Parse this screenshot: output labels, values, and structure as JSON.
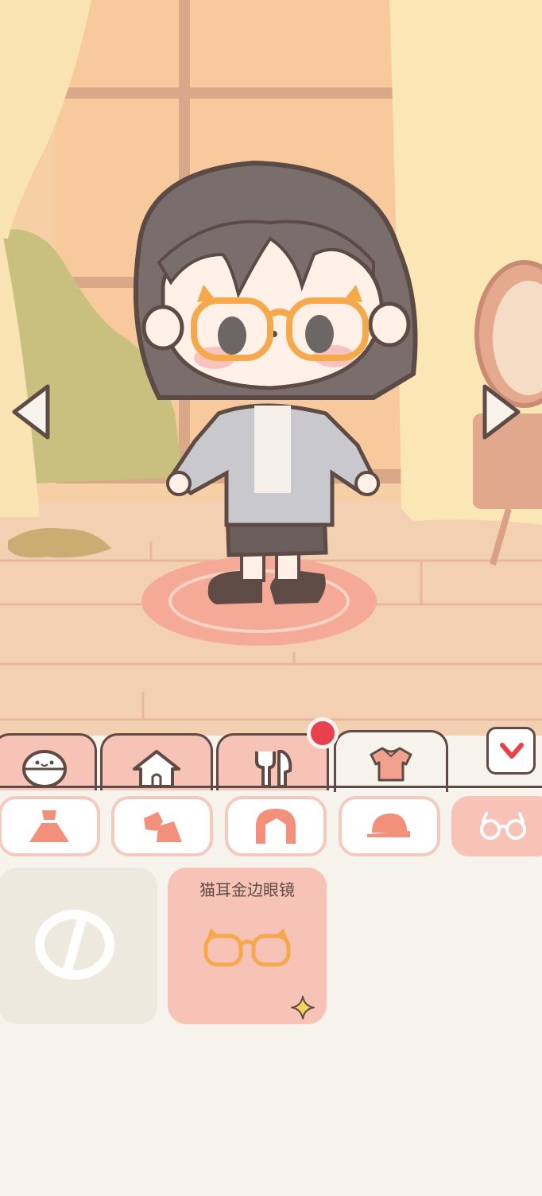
{
  "tabs": [
    {
      "id": "face",
      "icon": "face-icon"
    },
    {
      "id": "home",
      "icon": "home-icon"
    },
    {
      "id": "food",
      "icon": "fork-spoon-icon"
    },
    {
      "id": "clothes",
      "icon": "shirt-icon",
      "active": true
    }
  ],
  "notification": {
    "visible": true,
    "color": "#e8404c"
  },
  "categories": [
    {
      "id": "dress",
      "icon": "dress-icon"
    },
    {
      "id": "shoes",
      "icon": "shoes-icon"
    },
    {
      "id": "hair",
      "icon": "hair-icon"
    },
    {
      "id": "hat",
      "icon": "cap-icon"
    },
    {
      "id": "glasses",
      "icon": "glasses-icon",
      "selected": true
    }
  ],
  "items": [
    {
      "id": "none",
      "icon": "no-item-icon"
    },
    {
      "id": "cat-ear-glasses",
      "name": "猫耳金边眼镜",
      "icon": "cat-ear-glasses-icon",
      "badge": "sparkle-icon",
      "selected": true
    }
  ],
  "colors": {
    "accent": "#f7c3b7",
    "outline": "#5e4b45",
    "background": "#f6f2ec",
    "glasses": "#f5a94a"
  }
}
